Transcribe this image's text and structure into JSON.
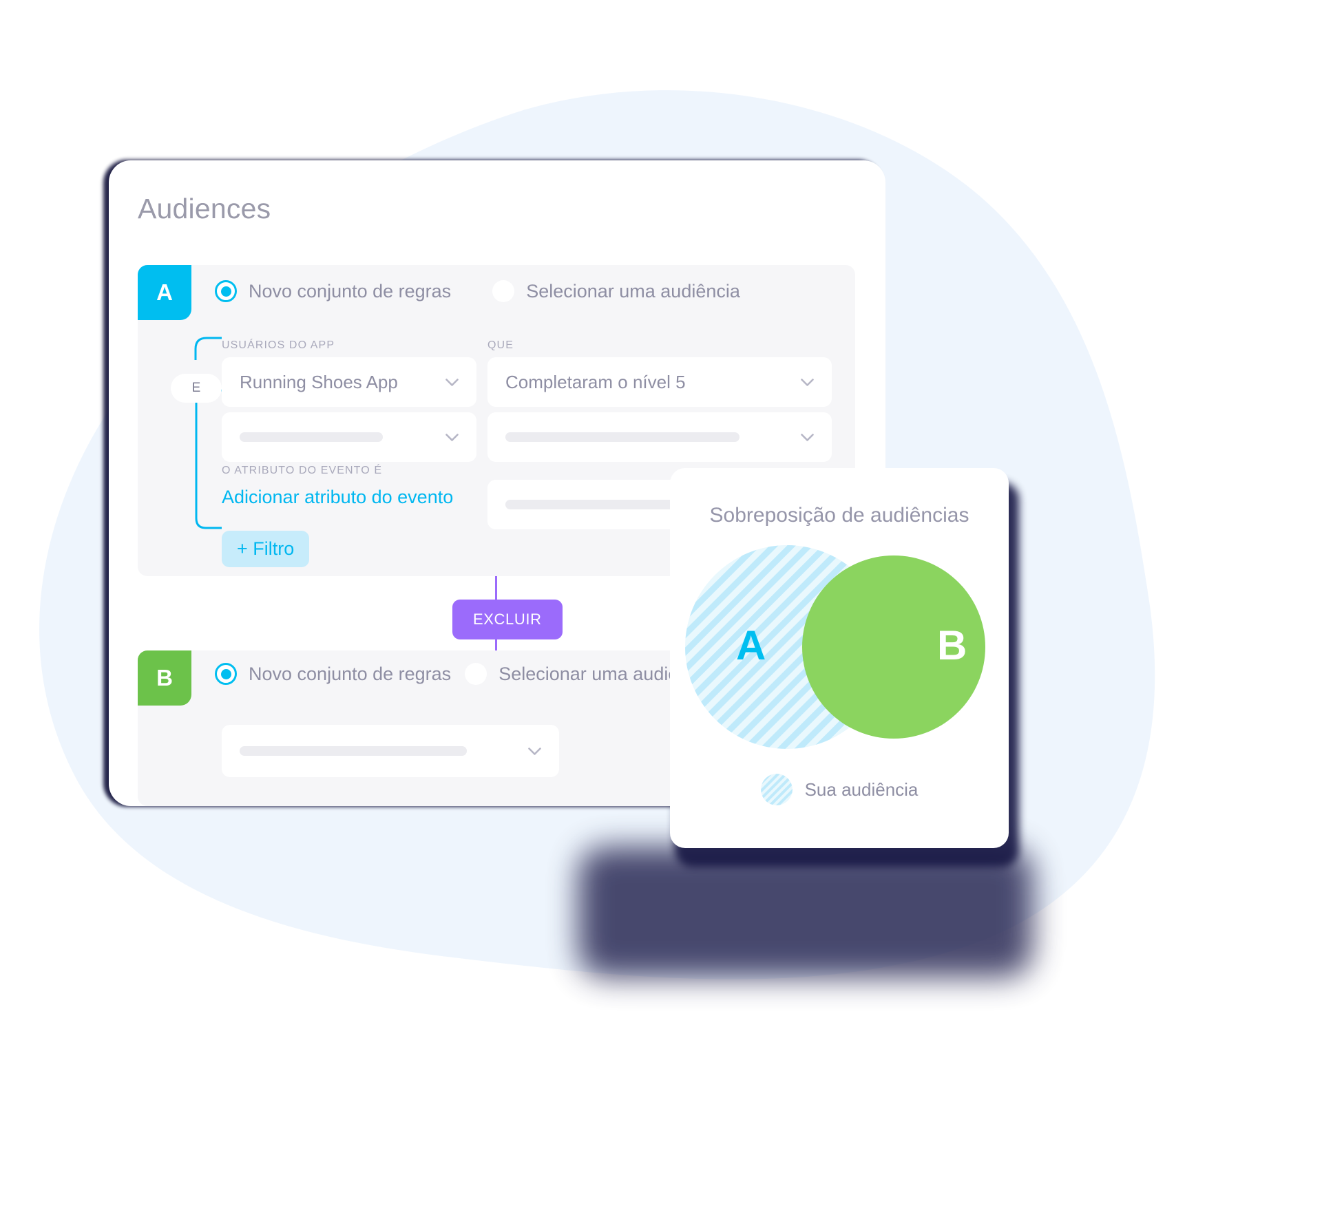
{
  "page": {
    "title": "Audiences"
  },
  "section_a": {
    "badge": "A",
    "radio_new_rules": "Novo conjunto de regras",
    "radio_select_audience": "Selecionar uma audiência",
    "label_app_users": "USUÁRIOS DO APP",
    "label_que": "QUE",
    "select_app_value": "Running Shoes App",
    "select_que_value": "Completaram o nível 5",
    "label_event_attribute": "O ATRIBUTO DO EVENTO É",
    "link_add_event_attribute": "Adicionar atributo do evento",
    "chip_add_filter": "+ Filtro",
    "connector_operator": "E"
  },
  "section_b": {
    "badge": "B",
    "radio_new_rules": "Novo conjunto de regras",
    "radio_select_audience": "Selecionar uma audiência"
  },
  "middle": {
    "exclude_button": "EXCLUIR"
  },
  "venn": {
    "title": "Sobreposição de audiências",
    "circle_a_label": "A",
    "circle_b_label": "B",
    "legend_label": "Sua audiência"
  },
  "colors": {
    "accent_cyan": "#00bef0",
    "accent_green": "#6cc24a",
    "accent_purple": "#9b6bfb",
    "link_blue": "#00b7f0",
    "chip_bg": "#c7ecfb",
    "text_muted": "#8e8ea3",
    "panel_bg": "#f6f6f8",
    "backdrop_blob": "#eef5fd",
    "venn_a_stripe": "#bfeafb",
    "venn_a_fill": "#e8f7fd",
    "venn_b_fill": "#8bd45f"
  }
}
